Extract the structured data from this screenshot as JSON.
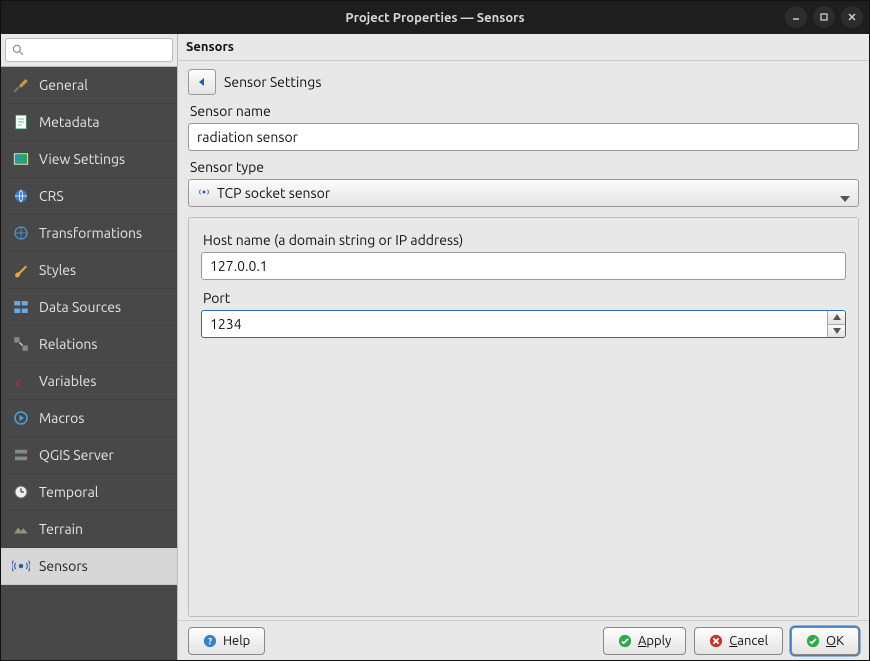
{
  "window": {
    "title": "Project Properties — Sensors"
  },
  "search": {
    "placeholder": ""
  },
  "sidebar": {
    "items": [
      {
        "label": "General"
      },
      {
        "label": "Metadata"
      },
      {
        "label": "View Settings"
      },
      {
        "label": "CRS"
      },
      {
        "label": "Transformations"
      },
      {
        "label": "Styles"
      },
      {
        "label": "Data Sources"
      },
      {
        "label": "Relations"
      },
      {
        "label": "Variables"
      },
      {
        "label": "Macros"
      },
      {
        "label": "QGIS Server"
      },
      {
        "label": "Temporal"
      },
      {
        "label": "Terrain"
      },
      {
        "label": "Sensors"
      }
    ],
    "selected_index": 13
  },
  "main": {
    "header": "Sensors",
    "breadcrumb": "Sensor Settings",
    "sensor_name_label": "Sensor name",
    "sensor_name_value": "radiation sensor",
    "sensor_type_label": "Sensor type",
    "sensor_type_value": "TCP socket sensor",
    "host_label": "Host name (a domain string or IP address)",
    "host_value": "127.0.0.1",
    "port_label": "Port",
    "port_value": "1234"
  },
  "footer": {
    "help": "Help",
    "apply": "Apply",
    "cancel": "Cancel",
    "ok": "OK"
  }
}
